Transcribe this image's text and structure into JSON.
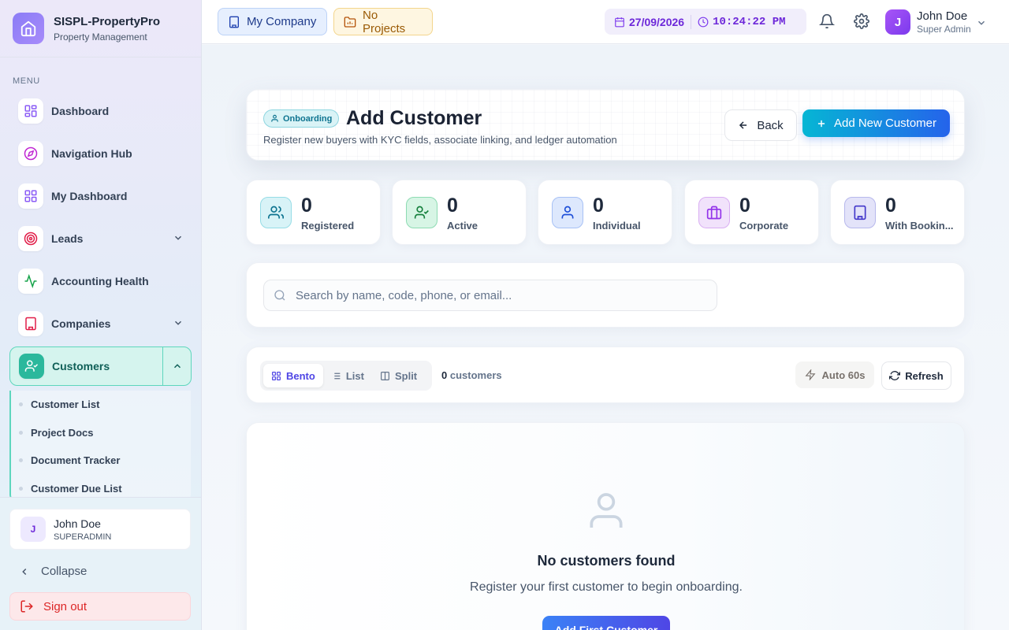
{
  "app": {
    "name": "SISPL-PropertyPro",
    "subtitle": "Property Management"
  },
  "sidebar": {
    "menu_label": "MENU",
    "items": [
      {
        "label": "Dashboard",
        "icon": "grid-icon"
      },
      {
        "label": "Navigation Hub",
        "icon": "compass-icon"
      },
      {
        "label": "My Dashboard",
        "icon": "grid-icon"
      },
      {
        "label": "Leads",
        "icon": "target-icon"
      },
      {
        "label": "Accounting Health",
        "icon": "activity-icon"
      },
      {
        "label": "Companies",
        "icon": "building-icon"
      },
      {
        "label": "Customers",
        "icon": "user-check-icon",
        "active": true
      }
    ],
    "submenu": [
      "Customer List",
      "Project Docs",
      "Document Tracker",
      "Customer Due List"
    ],
    "user": {
      "initial": "J",
      "name": "John Doe",
      "role": "SUPERADMIN"
    },
    "collapse_label": "Collapse",
    "signout_label": "Sign out"
  },
  "topbar": {
    "company": "My Company",
    "projects": "No Projects",
    "date": "27/09/2026",
    "time": "10:24:22 PM",
    "user": {
      "initial": "J",
      "name": "John Doe",
      "role": "Super Admin"
    }
  },
  "header": {
    "badge": "Onboarding",
    "title": "Add Customer",
    "subtitle": "Register new buyers with KYC fields, associate linking, and ledger automation",
    "back_label": "Back",
    "add_label": "Add New Customer"
  },
  "stats": [
    {
      "value": "0",
      "label": "Registered"
    },
    {
      "value": "0",
      "label": "Active"
    },
    {
      "value": "0",
      "label": "Individual"
    },
    {
      "value": "0",
      "label": "Corporate"
    },
    {
      "value": "0",
      "label": "With Bookin..."
    }
  ],
  "search": {
    "placeholder": "Search by name, code, phone, or email..."
  },
  "view": {
    "modes": [
      "Bento",
      "List",
      "Split"
    ],
    "active_mode": "Bento",
    "count_value": "0",
    "count_label": "customers",
    "auto_label": "Auto 60s",
    "refresh_label": "Refresh"
  },
  "empty": {
    "title": "No customers found",
    "subtitle": "Register your first customer to begin onboarding.",
    "button": "Add First Customer"
  },
  "colors": {
    "accent": "#2bb89c",
    "primary": "#2563eb",
    "brand": "#8b7cf6",
    "danger": "#dc2626"
  }
}
